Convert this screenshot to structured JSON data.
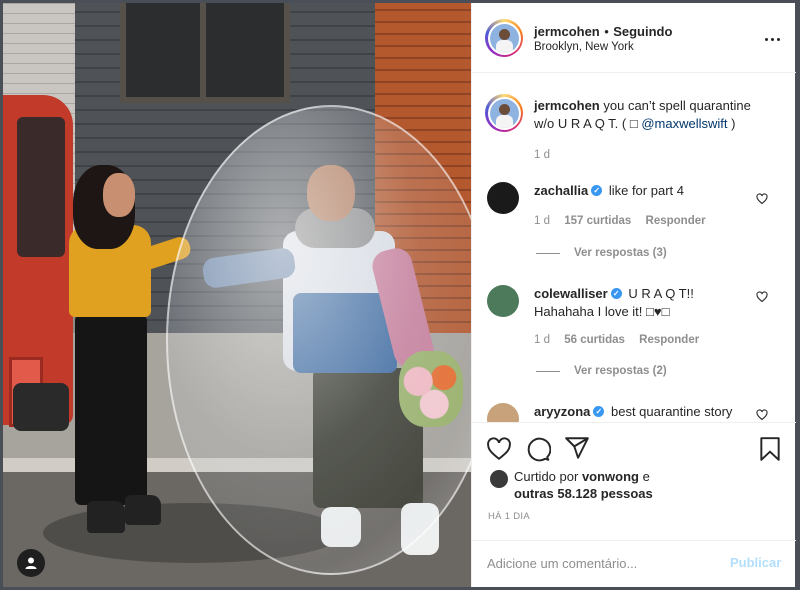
{
  "post": {
    "username": "jermcohen",
    "separator": "•",
    "follow_status": "Seguindo",
    "location": "Brooklyn, New York",
    "caption_user": "jermcohen",
    "caption_text": "you can’t spell quarantine w/o U R A Q T. ( □",
    "caption_mention": "@maxwellswift",
    "caption_end": ")",
    "caption_time": "1 d"
  },
  "comments": [
    {
      "user": "zachallia",
      "verified": true,
      "text": "like for part 4",
      "time": "1 d",
      "likes": "157 curtidas",
      "reply": "Responder",
      "view_replies": "Ver respostas (3)",
      "avatar_color": "#1a1a1a"
    },
    {
      "user": "colewalliser",
      "verified": true,
      "text": "U R A Q T!!",
      "text_line2": "Hahahaha I love it! □♥□",
      "time": "1 d",
      "likes": "56 curtidas",
      "reply": "Responder",
      "view_replies": "Ver respostas (2)",
      "avatar_color": "#4c7a5a"
    },
    {
      "user": "aryyzona",
      "verified": true,
      "text": "best quarantine story",
      "avatar_color": "#c7a27a"
    }
  ],
  "likes": {
    "prefix": "Curtido por",
    "liker": "vonwong",
    "connector": "e",
    "others": "outras 58.128 pessoas"
  },
  "date_label": "HÁ 1 DIA",
  "comment_box": {
    "placeholder": "Adicione um comentário...",
    "publish_label": "Publicar"
  },
  "icons": {
    "more": "more-options-icon",
    "like": "heart-icon",
    "comment": "comment-icon",
    "share": "share-icon",
    "save": "bookmark-icon",
    "verified": "verified-badge-icon",
    "user": "user-tag-icon"
  },
  "colors": {
    "verified": "#3897f0",
    "link": "#00376b",
    "publish_disabled": "#b2dffc",
    "muted": "#8e8e8e"
  }
}
